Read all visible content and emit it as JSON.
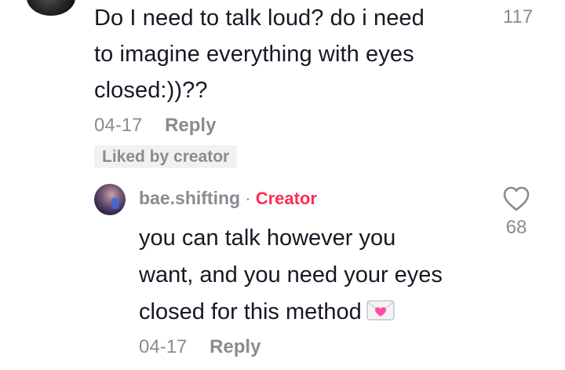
{
  "parent_comment": {
    "text_lines": [
      "Do I need to talk loud? do i need",
      "to imagine everything with eyes",
      "closed:))??"
    ],
    "like_count": "117",
    "date": "04-17",
    "reply_label": "Reply",
    "badge": "Liked by creator",
    "heart_icon": "heart-outline-icon"
  },
  "reply_comment": {
    "username": "bae.shifting",
    "separator": "·",
    "creator_tag": "Creator",
    "text_lines": [
      "you can talk however you",
      "want, and you need your eyes",
      "closed for this method"
    ],
    "emoji_icon": "love-letter-emoji-icon",
    "like_count": "68",
    "date": "04-17",
    "reply_label": "Reply",
    "heart_icon": "heart-outline-icon"
  },
  "colors": {
    "text_primary": "#161823",
    "text_secondary": "#8a8b91",
    "creator_accent": "#fe2c55",
    "badge_bg": "#f1f1f2"
  }
}
